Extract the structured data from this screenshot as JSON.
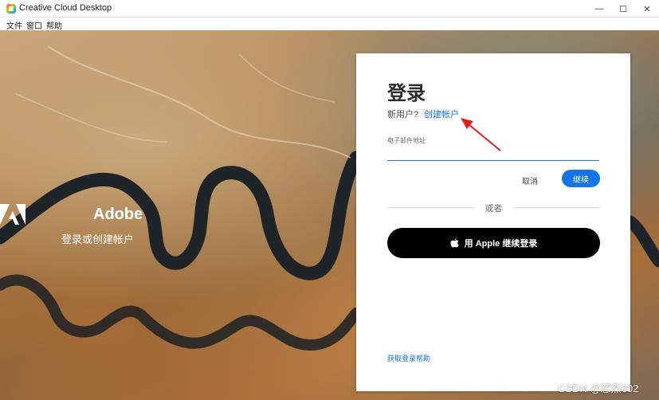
{
  "window": {
    "title": "Creative Cloud Desktop",
    "controls": {
      "minimize": "—",
      "maximize": "☐",
      "close": "✕"
    }
  },
  "menu": {
    "items": [
      "文件",
      "窗口",
      "帮助"
    ]
  },
  "branding": {
    "name": "Adobe",
    "tagline": "登录或创建帐户"
  },
  "login": {
    "heading": "登录",
    "new_user": "新用户?",
    "create_account": "创建帐户",
    "email_label": "电子邮件地址",
    "email_value": "",
    "cancel": "取消",
    "continue": "继续",
    "or": "或者",
    "apple_signin": "用 Apple 继续登录",
    "help": "获取登录帮助"
  },
  "watermark": "CSDN @忽然602",
  "colors": {
    "accent": "#1473e6",
    "annotation_arrow": "#e02020"
  }
}
